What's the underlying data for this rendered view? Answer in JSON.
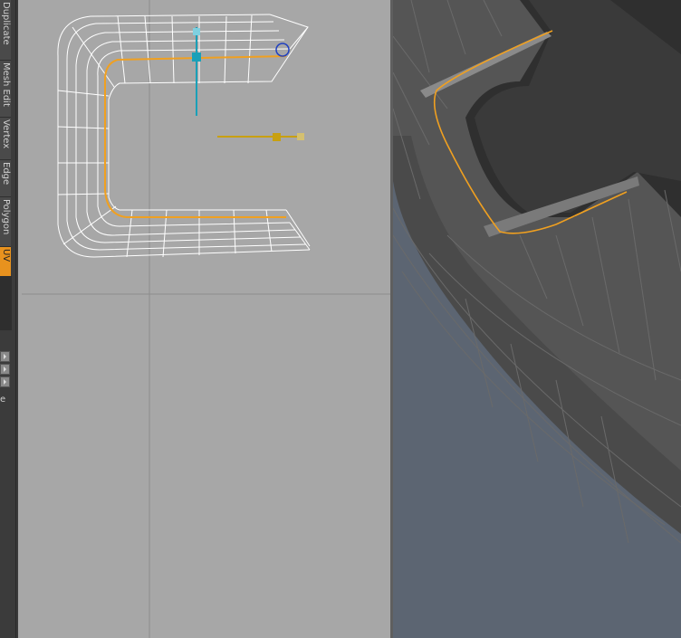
{
  "toolstrip": {
    "tabs": [
      {
        "label": "Duplicate",
        "active": false
      },
      {
        "label": "Mesh Edit",
        "active": false
      },
      {
        "label": "Vertex",
        "active": false
      },
      {
        "label": "Edge",
        "active": false
      },
      {
        "label": "Polygon",
        "active": false
      },
      {
        "label": "UV",
        "active": true
      }
    ],
    "bottom_label": "e",
    "accent_color": "#e8921e"
  },
  "viewport_left": {
    "background": "#a7a7a7",
    "selection_color": "#f0a020",
    "gizmo_y_color": "#1aa0b8",
    "gizmo_x_color": "#c8a010"
  },
  "viewport_right": {
    "background": "#5c6572",
    "mesh_color": "#3a3a3a"
  }
}
